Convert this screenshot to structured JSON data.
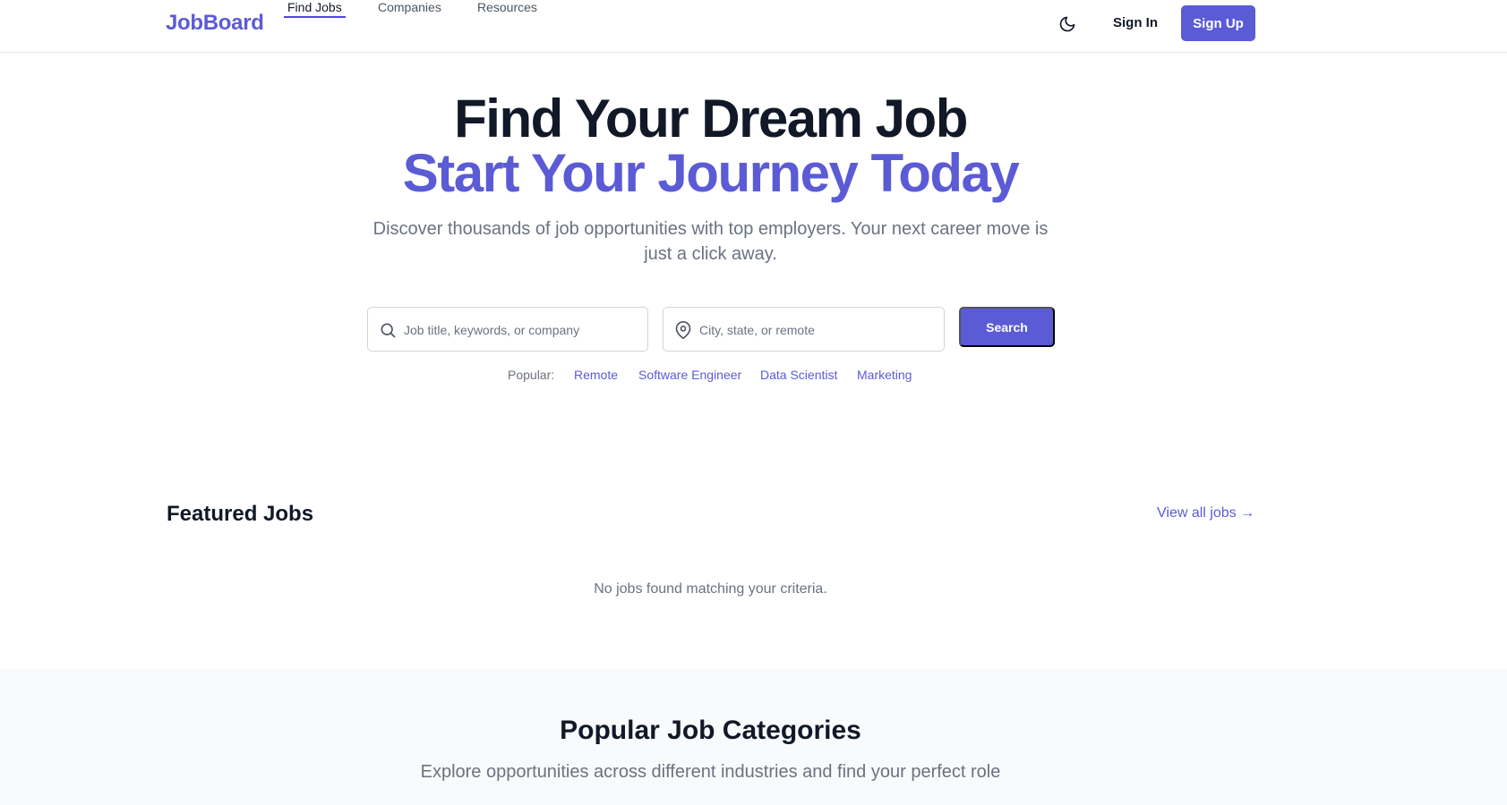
{
  "header": {
    "logo": "JobBoard",
    "nav": [
      {
        "label": "Find Jobs",
        "active": true
      },
      {
        "label": "Companies",
        "active": false
      },
      {
        "label": "Resources",
        "active": false
      }
    ],
    "theme_icon": "moon-icon",
    "sign_in": "Sign In",
    "sign_up": "Sign Up"
  },
  "hero": {
    "title_line1": "Find Your Dream Job",
    "title_line2": "Start Your Journey Today",
    "subtitle": "Discover thousands of job opportunities with top employers. Your next career move is just a click away.",
    "search": {
      "keyword_placeholder": "Job title, keywords, or company",
      "keyword_icon": "search-icon",
      "location_placeholder": "City, state, or remote",
      "location_icon": "map-pin-icon",
      "button": "Search"
    },
    "popular": {
      "label": "Popular:",
      "tags": [
        "Remote",
        "Software Engineer",
        "Data Scientist",
        "Marketing"
      ]
    }
  },
  "featured": {
    "title": "Featured Jobs",
    "view_all": "View all jobs →",
    "empty_message": "No jobs found matching your criteria."
  },
  "categories": {
    "title": "Popular Job Categories",
    "subtitle": "Explore opportunities across different industries and find your perfect role"
  },
  "colors": {
    "accent": "#5b5bd6",
    "text_dark": "#111827",
    "text_muted": "#6b7280",
    "section_bg": "#f9fafb"
  }
}
